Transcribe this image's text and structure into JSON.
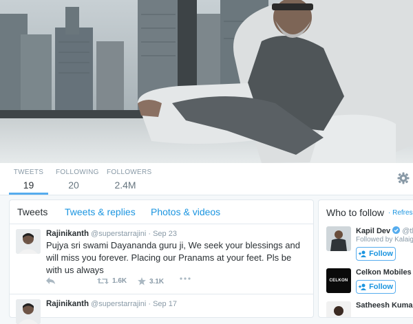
{
  "profile_nav": {
    "stats": [
      {
        "label": "TWEETS",
        "value": "19"
      },
      {
        "label": "FOLLOWING",
        "value": "20"
      },
      {
        "label": "FOLLOWERS",
        "value": "2.4M"
      }
    ],
    "active_stat": "TWEETS"
  },
  "timeline": {
    "tabs": [
      "Tweets",
      "Tweets & replies",
      "Photos & videos"
    ],
    "active_tab": "Tweets",
    "tweets": [
      {
        "name": "Rajinikanth",
        "handle": "@superstarrajini",
        "separator": "·",
        "date": "Sep 23",
        "text": "Pujya sri swami Dayananda guru ji, We seek your blessings and will miss you forever. Placing our Pranams at your feet. Pls be with us always",
        "retweets": "1.6K",
        "likes": "3.1K"
      },
      {
        "name": "Rajinikanth",
        "handle": "@superstarrajini",
        "separator": "·",
        "date": "Sep 17"
      }
    ]
  },
  "who_to_follow": {
    "title": "Who to follow",
    "refresh_label": "· Refresh ·",
    "suggestions": [
      {
        "name": "Kapil Dev",
        "handle": "@th",
        "sub": "Followed by Kalaig",
        "follow_label": "Follow"
      },
      {
        "name": "Celkon Mobiles",
        "handle": "@",
        "avatar_text": "CELKON",
        "follow_label": "Follow"
      },
      {
        "name": "Satheesh Kumar",
        "handle": "@"
      }
    ]
  },
  "colors": {
    "accent": "#55acee",
    "link": "#1b95e0",
    "muted": "#8899a6"
  }
}
